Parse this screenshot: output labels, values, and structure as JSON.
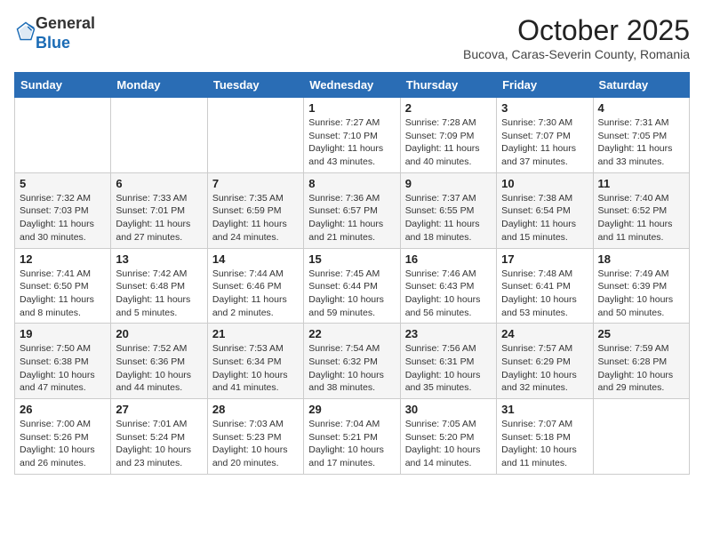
{
  "header": {
    "logo_line1": "General",
    "logo_line2": "Blue",
    "month": "October 2025",
    "location": "Bucova, Caras-Severin County, Romania"
  },
  "weekdays": [
    "Sunday",
    "Monday",
    "Tuesday",
    "Wednesday",
    "Thursday",
    "Friday",
    "Saturday"
  ],
  "weeks": [
    [
      {
        "day": "",
        "info": ""
      },
      {
        "day": "",
        "info": ""
      },
      {
        "day": "",
        "info": ""
      },
      {
        "day": "1",
        "info": "Sunrise: 7:27 AM\nSunset: 7:10 PM\nDaylight: 11 hours\nand 43 minutes."
      },
      {
        "day": "2",
        "info": "Sunrise: 7:28 AM\nSunset: 7:09 PM\nDaylight: 11 hours\nand 40 minutes."
      },
      {
        "day": "3",
        "info": "Sunrise: 7:30 AM\nSunset: 7:07 PM\nDaylight: 11 hours\nand 37 minutes."
      },
      {
        "day": "4",
        "info": "Sunrise: 7:31 AM\nSunset: 7:05 PM\nDaylight: 11 hours\nand 33 minutes."
      }
    ],
    [
      {
        "day": "5",
        "info": "Sunrise: 7:32 AM\nSunset: 7:03 PM\nDaylight: 11 hours\nand 30 minutes."
      },
      {
        "day": "6",
        "info": "Sunrise: 7:33 AM\nSunset: 7:01 PM\nDaylight: 11 hours\nand 27 minutes."
      },
      {
        "day": "7",
        "info": "Sunrise: 7:35 AM\nSunset: 6:59 PM\nDaylight: 11 hours\nand 24 minutes."
      },
      {
        "day": "8",
        "info": "Sunrise: 7:36 AM\nSunset: 6:57 PM\nDaylight: 11 hours\nand 21 minutes."
      },
      {
        "day": "9",
        "info": "Sunrise: 7:37 AM\nSunset: 6:55 PM\nDaylight: 11 hours\nand 18 minutes."
      },
      {
        "day": "10",
        "info": "Sunrise: 7:38 AM\nSunset: 6:54 PM\nDaylight: 11 hours\nand 15 minutes."
      },
      {
        "day": "11",
        "info": "Sunrise: 7:40 AM\nSunset: 6:52 PM\nDaylight: 11 hours\nand 11 minutes."
      }
    ],
    [
      {
        "day": "12",
        "info": "Sunrise: 7:41 AM\nSunset: 6:50 PM\nDaylight: 11 hours\nand 8 minutes."
      },
      {
        "day": "13",
        "info": "Sunrise: 7:42 AM\nSunset: 6:48 PM\nDaylight: 11 hours\nand 5 minutes."
      },
      {
        "day": "14",
        "info": "Sunrise: 7:44 AM\nSunset: 6:46 PM\nDaylight: 11 hours\nand 2 minutes."
      },
      {
        "day": "15",
        "info": "Sunrise: 7:45 AM\nSunset: 6:44 PM\nDaylight: 10 hours\nand 59 minutes."
      },
      {
        "day": "16",
        "info": "Sunrise: 7:46 AM\nSunset: 6:43 PM\nDaylight: 10 hours\nand 56 minutes."
      },
      {
        "day": "17",
        "info": "Sunrise: 7:48 AM\nSunset: 6:41 PM\nDaylight: 10 hours\nand 53 minutes."
      },
      {
        "day": "18",
        "info": "Sunrise: 7:49 AM\nSunset: 6:39 PM\nDaylight: 10 hours\nand 50 minutes."
      }
    ],
    [
      {
        "day": "19",
        "info": "Sunrise: 7:50 AM\nSunset: 6:38 PM\nDaylight: 10 hours\nand 47 minutes."
      },
      {
        "day": "20",
        "info": "Sunrise: 7:52 AM\nSunset: 6:36 PM\nDaylight: 10 hours\nand 44 minutes."
      },
      {
        "day": "21",
        "info": "Sunrise: 7:53 AM\nSunset: 6:34 PM\nDaylight: 10 hours\nand 41 minutes."
      },
      {
        "day": "22",
        "info": "Sunrise: 7:54 AM\nSunset: 6:32 PM\nDaylight: 10 hours\nand 38 minutes."
      },
      {
        "day": "23",
        "info": "Sunrise: 7:56 AM\nSunset: 6:31 PM\nDaylight: 10 hours\nand 35 minutes."
      },
      {
        "day": "24",
        "info": "Sunrise: 7:57 AM\nSunset: 6:29 PM\nDaylight: 10 hours\nand 32 minutes."
      },
      {
        "day": "25",
        "info": "Sunrise: 7:59 AM\nSunset: 6:28 PM\nDaylight: 10 hours\nand 29 minutes."
      }
    ],
    [
      {
        "day": "26",
        "info": "Sunrise: 7:00 AM\nSunset: 5:26 PM\nDaylight: 10 hours\nand 26 minutes."
      },
      {
        "day": "27",
        "info": "Sunrise: 7:01 AM\nSunset: 5:24 PM\nDaylight: 10 hours\nand 23 minutes."
      },
      {
        "day": "28",
        "info": "Sunrise: 7:03 AM\nSunset: 5:23 PM\nDaylight: 10 hours\nand 20 minutes."
      },
      {
        "day": "29",
        "info": "Sunrise: 7:04 AM\nSunset: 5:21 PM\nDaylight: 10 hours\nand 17 minutes."
      },
      {
        "day": "30",
        "info": "Sunrise: 7:05 AM\nSunset: 5:20 PM\nDaylight: 10 hours\nand 14 minutes."
      },
      {
        "day": "31",
        "info": "Sunrise: 7:07 AM\nSunset: 5:18 PM\nDaylight: 10 hours\nand 11 minutes."
      },
      {
        "day": "",
        "info": ""
      }
    ]
  ]
}
